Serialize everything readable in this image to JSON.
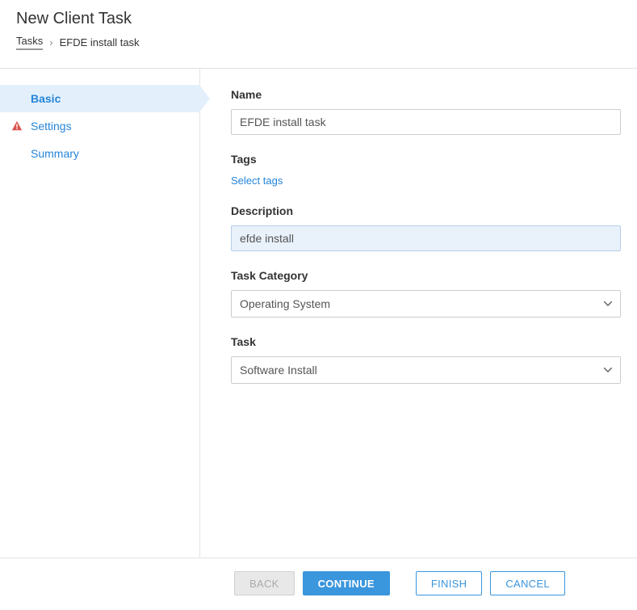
{
  "header": {
    "title": "New Client Task",
    "breadcrumb": {
      "root": "Tasks",
      "current": "EFDE install task"
    }
  },
  "sidebar": {
    "items": [
      {
        "label": "Basic",
        "active": true,
        "warning": false
      },
      {
        "label": "Settings",
        "active": false,
        "warning": true
      },
      {
        "label": "Summary",
        "active": false,
        "warning": false
      }
    ]
  },
  "form": {
    "name": {
      "label": "Name",
      "value": "EFDE install task"
    },
    "tags": {
      "label": "Tags",
      "link": "Select tags"
    },
    "description": {
      "label": "Description",
      "value": "efde install"
    },
    "task_category": {
      "label": "Task Category",
      "value": "Operating System"
    },
    "task": {
      "label": "Task",
      "value": "Software Install"
    }
  },
  "footer": {
    "back": "BACK",
    "continue": "CONTINUE",
    "finish": "FINISH",
    "cancel": "CANCEL"
  }
}
